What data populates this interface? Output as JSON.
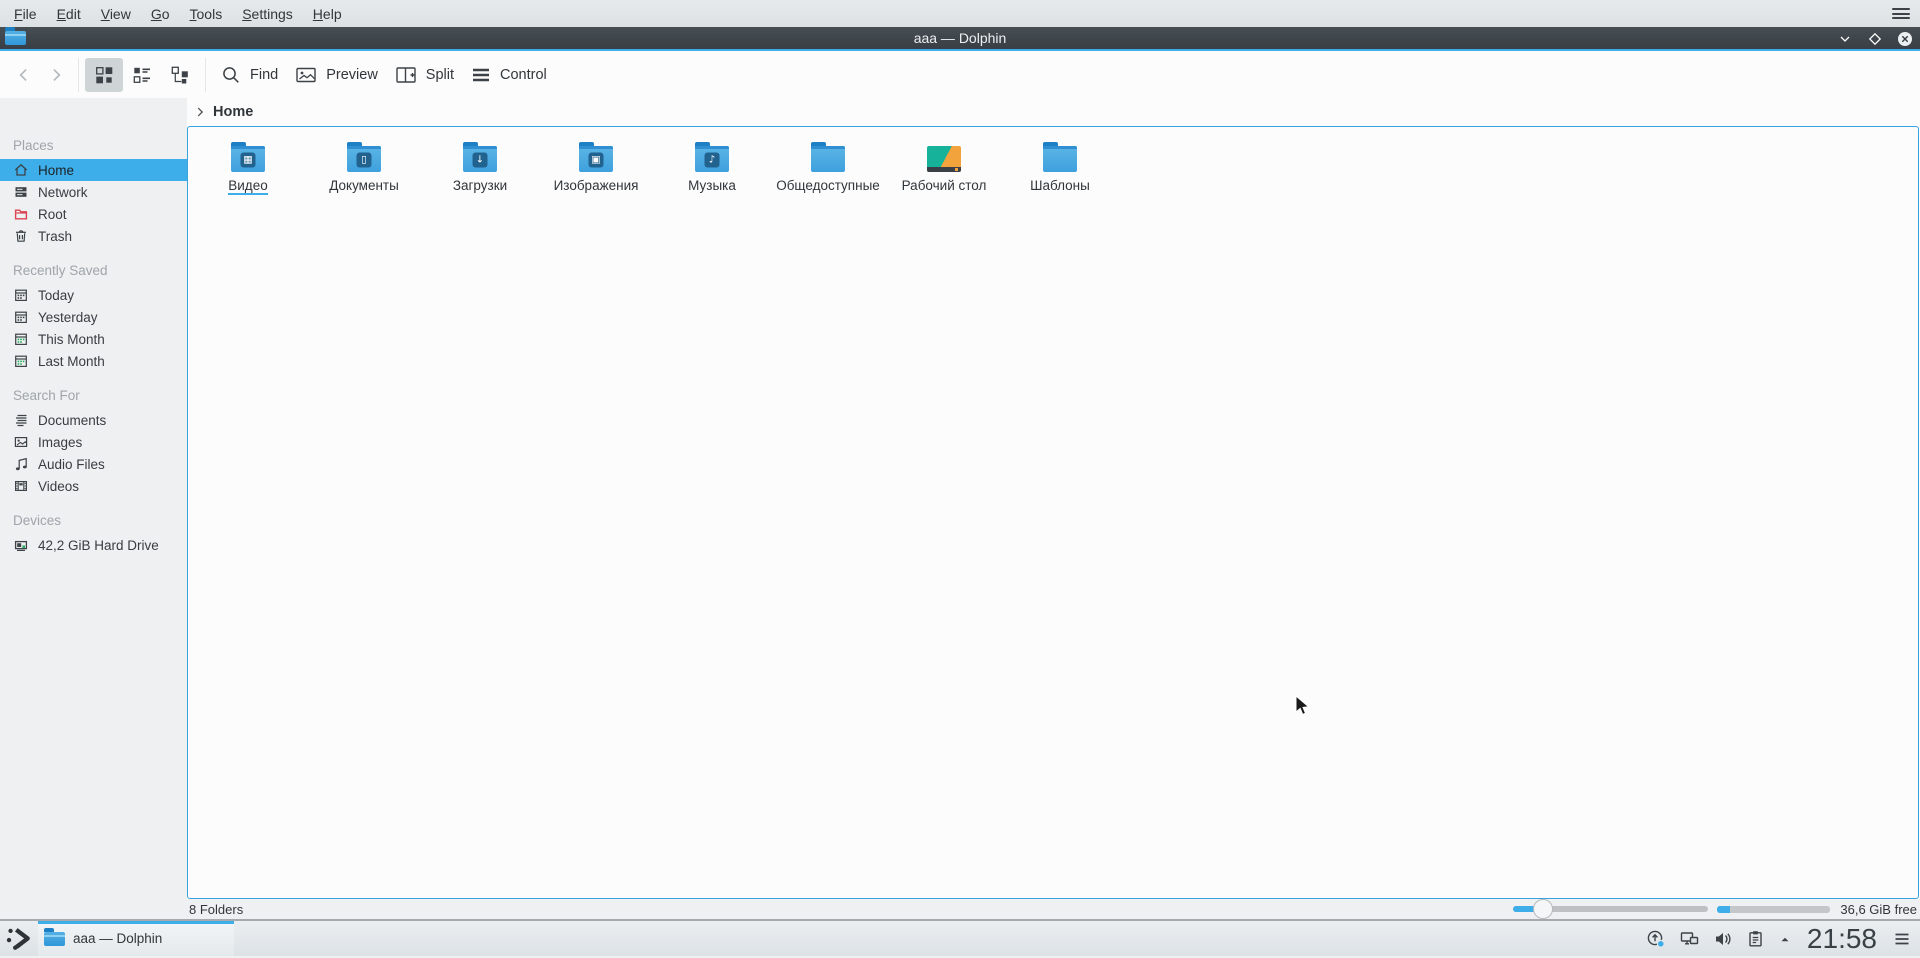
{
  "global_menu": {
    "items": [
      "File",
      "Edit",
      "View",
      "Go",
      "Tools",
      "Settings",
      "Help"
    ]
  },
  "window": {
    "title": "aaa — Dolphin",
    "buttons": [
      "minimize",
      "maximize",
      "close"
    ]
  },
  "toolbar": {
    "find": "Find",
    "preview": "Preview",
    "split": "Split",
    "control": "Control",
    "view_modes": [
      "icons",
      "compact",
      "details"
    ],
    "selected_view_mode": "icons"
  },
  "breadcrumb": {
    "current": "Home"
  },
  "sidebar": {
    "sections": [
      {
        "header": "Places",
        "items": [
          {
            "key": "home",
            "label": "Home",
            "icon": "home-icon",
            "selected": true
          },
          {
            "key": "network",
            "label": "Network",
            "icon": "network-icon"
          },
          {
            "key": "root",
            "label": "Root",
            "icon": "root-icon"
          },
          {
            "key": "trash",
            "label": "Trash",
            "icon": "trash-icon"
          }
        ]
      },
      {
        "header": "Recently Saved",
        "items": [
          {
            "key": "today",
            "label": "Today",
            "icon": "calendar-icon"
          },
          {
            "key": "yesterday",
            "label": "Yesterday",
            "icon": "calendar-icon"
          },
          {
            "key": "this-month",
            "label": "This Month",
            "icon": "calendar-green-icon"
          },
          {
            "key": "last-month",
            "label": "Last Month",
            "icon": "calendar-green-icon"
          }
        ]
      },
      {
        "header": "Search For",
        "items": [
          {
            "key": "documents",
            "label": "Documents",
            "icon": "documents-icon"
          },
          {
            "key": "images",
            "label": "Images",
            "icon": "images-icon"
          },
          {
            "key": "audio-files",
            "label": "Audio Files",
            "icon": "audio-icon"
          },
          {
            "key": "videos",
            "label": "Videos",
            "icon": "videos-icon"
          }
        ]
      },
      {
        "header": "Devices",
        "items": [
          {
            "key": "hard-drive",
            "label": "42,2 GiB Hard Drive",
            "icon": "drive-icon"
          }
        ]
      }
    ]
  },
  "folders": {
    "items": [
      {
        "key": "video",
        "label": "Видео",
        "emblem": "video",
        "underlined": true
      },
      {
        "key": "documents",
        "label": "Документы",
        "emblem": "document"
      },
      {
        "key": "downloads",
        "label": "Загрузки",
        "emblem": "download"
      },
      {
        "key": "images",
        "label": "Изображения",
        "emblem": "image"
      },
      {
        "key": "music",
        "label": "Музыка",
        "emblem": "music"
      },
      {
        "key": "public",
        "label": "Общедоступные",
        "emblem": null
      },
      {
        "key": "desktop",
        "label": "Рабочий стол",
        "emblem": null,
        "special": "desktop"
      },
      {
        "key": "templates",
        "label": "Шаблоны",
        "emblem": null
      }
    ]
  },
  "statusbar": {
    "items_label": "8 Folders",
    "free_label": "36,6 GiB free",
    "zoom_slider_percent": 15,
    "capacity_used_percent": 13
  },
  "taskbar": {
    "task_label": "aaa — Dolphin",
    "clock": "21:58",
    "tray": [
      "software-updates",
      "network",
      "volume",
      "clipboard",
      "tray-expander"
    ]
  },
  "colors": {
    "accent": "#3daee9",
    "titlebar": "#3e444a",
    "selection": "#3daee9",
    "folder_blue": "#3da0dd",
    "root_red": "#da4453"
  }
}
